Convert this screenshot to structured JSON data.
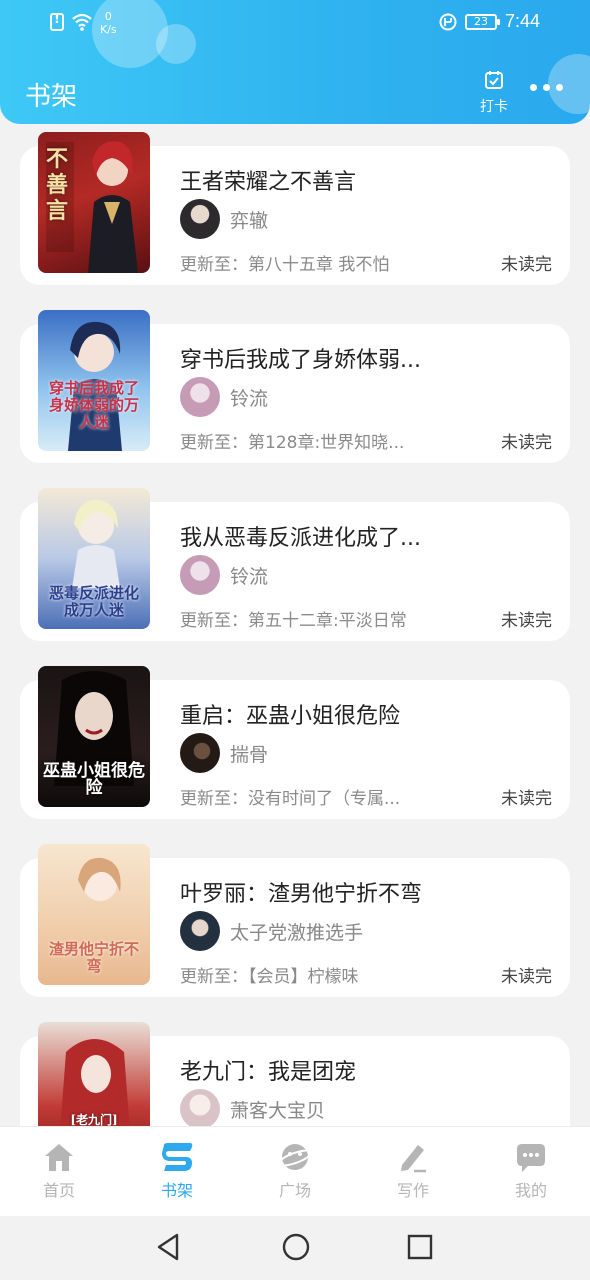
{
  "status_bar": {
    "net_speed_value": "0",
    "net_speed_unit": "K/s",
    "battery": "23",
    "time": "7:44"
  },
  "header": {
    "title": "书架",
    "checkin_label": "打卡"
  },
  "book_label_prefix": "更新至：",
  "books": [
    {
      "title": "王者荣耀之不善言",
      "author": "弈辙",
      "update": "第八十五章 我不怕",
      "status": "未读完",
      "cover_text": "不善言"
    },
    {
      "title": "穿书后我成了身娇体弱...",
      "author": "铃流",
      "update": "第128章:世界知晓...",
      "status": "未读完",
      "cover_text": "穿书后我成了身娇体弱的万人迷"
    },
    {
      "title": "我从恶毒反派进化成了...",
      "author": "铃流",
      "update": "第五十二章:平淡日常",
      "status": "未读完",
      "cover_text": "恶毒反派进化成万人迷"
    },
    {
      "title": "重启：巫蛊小姐很危险",
      "author": "揣骨",
      "update": "没有时间了（专属...",
      "status": "未读完",
      "cover_text": "巫蛊小姐很危险"
    },
    {
      "title": "叶罗丽：渣男他宁折不弯",
      "author": "太子党激推选手",
      "update": "【会员】柠檬味",
      "status": "未读完",
      "cover_text": "渣男他宁折不弯"
    },
    {
      "title": "老九门：我是团宠",
      "author": "萧客大宝贝",
      "update": "",
      "status": "",
      "cover_text": "[老九门]"
    }
  ],
  "tabs": [
    {
      "label": "首页",
      "icon": "home-icon"
    },
    {
      "label": "书架",
      "icon": "bookshelf-icon"
    },
    {
      "label": "广场",
      "icon": "planet-icon"
    },
    {
      "label": "写作",
      "icon": "pen-icon"
    },
    {
      "label": "我的",
      "icon": "chat-bubble-icon"
    }
  ],
  "colors": {
    "header_start": "#3ec8f6",
    "header_end": "#2aa9ee",
    "active_tab": "#2fa9ee",
    "inactive_tab": "#b5b5b5"
  }
}
